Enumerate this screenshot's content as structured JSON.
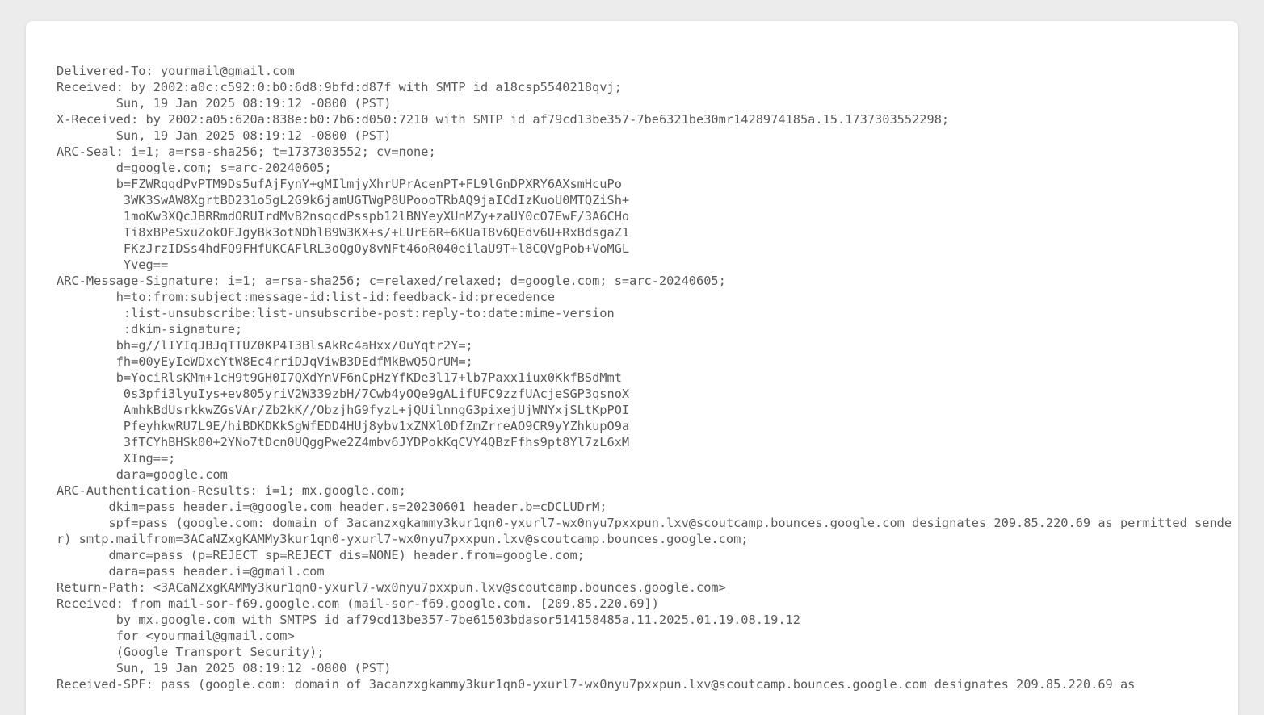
{
  "view": {
    "type": "email-raw-headers",
    "background_color": "#ececec",
    "card_color": "#ffffff",
    "text_color": "#5a5a5a"
  },
  "headers": {
    "lines": [
      "Delivered-To: yourmail@gmail.com",
      "Received: by 2002:a0c:c592:0:b0:6d8:9bfd:d87f with SMTP id a18csp5540218qvj;",
      "        Sun, 19 Jan 2025 08:19:12 -0800 (PST)",
      "X-Received: by 2002:a05:620a:838e:b0:7b6:d050:7210 with SMTP id af79cd13be357-7be6321be30mr1428974185a.15.1737303552298;",
      "        Sun, 19 Jan 2025 08:19:12 -0800 (PST)",
      "ARC-Seal: i=1; a=rsa-sha256; t=1737303552; cv=none;",
      "        d=google.com; s=arc-20240605;",
      "        b=FZWRqqdPvPTM9Ds5ufAjFynY+gMIlmjyXhrUPrAcenPT+FL9lGnDPXRY6AXsmHcuPo",
      "         3WK3SwAW8XgrtBD231o5gL2G9k6jamUGTWgP8UPoooTRbAQ9jaICdIzKuoU0MTQZiSh+",
      "         1moKw3XQcJBRRmdORUIrdMvB2nsqcdPsspb12lBNYeyXUnMZy+zaUY0cO7EwF/3A6CHo",
      "         Ti8xBPeSxuZokOFJgyBk3otNDhlB9W3KX+s/+LUrE6R+6KUaT8v6QEdv6U+RxBdsgaZ1",
      "         FKzJrzIDSs4hdFQ9FHfUKCAFlRL3oQgOy8vNFt46oR040eilaU9T+l8CQVgPob+VoMGL",
      "         Yveg==",
      "ARC-Message-Signature: i=1; a=rsa-sha256; c=relaxed/relaxed; d=google.com; s=arc-20240605;",
      "        h=to:from:subject:message-id:list-id:feedback-id:precedence",
      "         :list-unsubscribe:list-unsubscribe-post:reply-to:date:mime-version",
      "         :dkim-signature;",
      "        bh=g//lIYIqJBJqTTUZ0KP4T3BlsAkRc4aHxx/OuYqtr2Y=;",
      "        fh=00yEyIeWDxcYtW8Ec4rriDJqViwB3DEdfMkBwQ5OrUM=;",
      "        b=YociRlsKMm+1cH9t9GH0I7QXdYnVF6nCpHzYfKDe3l17+lb7Paxx1iux0KkfBSdMmt",
      "         0s3pfi3lyuIys+ev805yriV2W339zbH/7Cwb4yOQe9gALifUFC9zzfUAcjeSGP3qsnoX",
      "         AmhkBdUsrkkwZGsVAr/Zb2kK//ObzjhG9fyzL+jQUilnngG3pixejUjWNYxjSLtKpPOI",
      "         PfeyhkwRU7L9E/hiBDKDKkSgWfEDD4HUj8ybv1xZNXl0DfZmZrreAO9CR9yYZhkupO9a",
      "         3fTCYhBHSk00+2YNo7tDcn0UQggPwe2Z4mbv6JYDPokKqCVY4QBzFfhs9pt8Yl7zL6xM",
      "         XIng==;",
      "        dara=google.com",
      "ARC-Authentication-Results: i=1; mx.google.com;",
      "       dkim=pass header.i=@google.com header.s=20230601 header.b=cDCLUDrM;",
      "       spf=pass (google.com: domain of 3acanzxgkammy3kur1qn0-yxurl7-wx0nyu7pxxpun.lxv@scoutcamp.bounces.google.com designates 209.85.220.69 as permitted sender) smtp.mailfrom=3ACaNZxgKAMMy3kur1qn0-yxurl7-wx0nyu7pxxpun.lxv@scoutcamp.bounces.google.com;",
      "       dmarc=pass (p=REJECT sp=REJECT dis=NONE) header.from=google.com;",
      "       dara=pass header.i=@gmail.com",
      "Return-Path: <3ACaNZxgKAMMy3kur1qn0-yxurl7-wx0nyu7pxxpun.lxv@scoutcamp.bounces.google.com>",
      "Received: from mail-sor-f69.google.com (mail-sor-f69.google.com. [209.85.220.69])",
      "        by mx.google.com with SMTPS id af79cd13be357-7be61503bdasor514158485a.11.2025.01.19.08.19.12",
      "        for <yourmail@gmail.com>",
      "        (Google Transport Security);",
      "        Sun, 19 Jan 2025 08:19:12 -0800 (PST)",
      "Received-SPF: pass (google.com: domain of 3acanzxgkammy3kur1qn0-yxurl7-wx0nyu7pxxpun.lxv@scoutcamp.bounces.google.com designates 209.85.220.69 as"
    ]
  }
}
